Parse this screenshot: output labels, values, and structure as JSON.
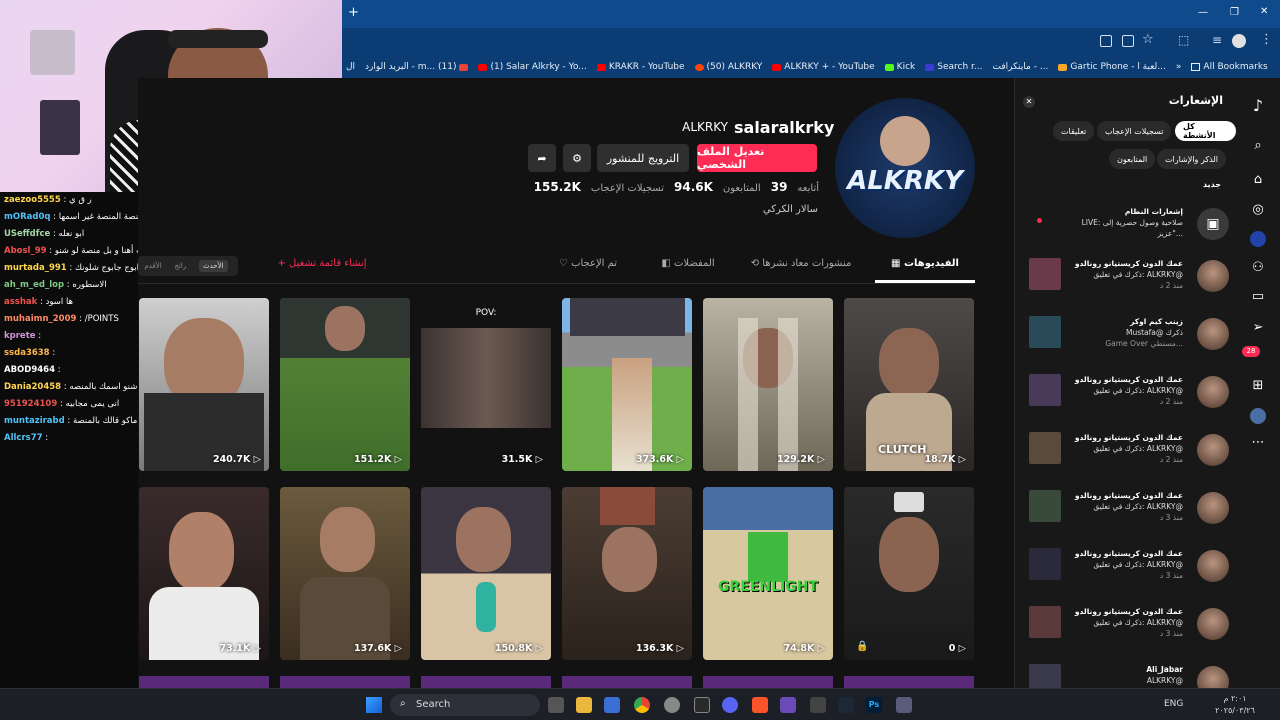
{
  "browser": {
    "new_tab_glyph": "+",
    "bookmarks": [
      {
        "label": "ماينكرافت - ...",
        "icon": "link-icon"
      },
      {
        "label": "Search r...",
        "icon": "kick-k-icon"
      },
      {
        "label": "Kick",
        "icon": "kick-icon"
      },
      {
        "label": "ALKRKY + - YouTube",
        "icon": "youtube-icon"
      },
      {
        "label": "(50) ALKRKY",
        "icon": "reddit-icon"
      },
      {
        "label": "KRAKR - YouTube",
        "icon": "youtube-icon"
      },
      {
        "label": "(1) Salar Alkrky - Yo...",
        "icon": "youtube-icon"
      },
      {
        "label": "البريد الوارد - m... (11)",
        "icon": "gmail-icon"
      },
      {
        "label": "ال",
        "icon": "link-icon"
      }
    ],
    "gartic": "Gartic Phone - لعبة ا...",
    "all_bookmarks": "All Bookmarks",
    "overflow": "»"
  },
  "profile": {
    "username": "salaralkrky",
    "display_name": "ALKRKY",
    "edit_profile": "تعديل الملف الشخصي",
    "promote": "الترويج للمنشور",
    "following_count": "39",
    "following_label": "أتابعه",
    "followers_count": "94.6K",
    "followers_label": "المتابعون",
    "likes_count": "155.2K",
    "likes_label": "تسجيلات الإعجاب",
    "bio": "سالار الكركي",
    "avatar_text": "ALKRKY"
  },
  "tabs": [
    {
      "label": "الفيديوهات",
      "active": true
    },
    {
      "label": "منشورات معاد نشرها",
      "active": false
    },
    {
      "label": "المفضلات",
      "active": false
    },
    {
      "label": "تم الإعجاب",
      "active": false
    }
  ],
  "sort": [
    "الأحدث",
    "رائج",
    "الأقدم"
  ],
  "create_playlist": "+ إنشاء قائمة تشغيل",
  "videos_row1": [
    {
      "views": "18.7K",
      "caption": "CLUTCH"
    },
    {
      "views": "129.2K"
    },
    {
      "views": "373.6K"
    },
    {
      "views": "31.5K",
      "caption": "POV:"
    },
    {
      "views": "151.2K"
    },
    {
      "views": "240.7K"
    }
  ],
  "videos_row2": [
    {
      "views": "0"
    },
    {
      "views": "74.8K",
      "caption": "GREENLIGHT"
    },
    {
      "views": "136.3K"
    },
    {
      "views": "150.8K"
    },
    {
      "views": "137.6K"
    },
    {
      "views": "73.1K"
    }
  ],
  "chat": [
    {
      "user": "zaezoo5555",
      "msg": ": ر ق ي",
      "color": "#ffd54f"
    },
    {
      "user": "mORad0q",
      "msg": ": اسم المنصة المنصة غير اسمها",
      "color": "#4fc3f7"
    },
    {
      "user": "USeffdfce",
      "msg": ": ابو نعله",
      "color": "#a5d6a7"
    },
    {
      "user": "Abosl_99",
      "msg": ": خاله راح بيت أهنا و بل منصة لو شنو",
      "color": "#ef5350"
    },
    {
      "user": "murtada_991",
      "msg": ": ابوج جابوج شلونك",
      "color": "#ffd54f"
    },
    {
      "user": "ah_m_ed_lop",
      "msg": ": الاسطوره",
      "color": "#81c784"
    },
    {
      "user": "asshak",
      "msg": ": ها اسود",
      "color": "#ef5350"
    },
    {
      "user": "muhaimn_2009",
      "msg": ": /POINTS",
      "color": "#ff8a65"
    },
    {
      "user": "kprete",
      "msg": ":",
      "color": "#ce93d8"
    },
    {
      "user": "ssda3638",
      "msg": ":",
      "color": "#ffb74d"
    },
    {
      "user": "ABOD9464",
      "msg": ":",
      "color": "#ffffff"
    },
    {
      "user": "Dania20458",
      "msg": ": شنو اسمك بالمنصه",
      "color": "#ffd54f"
    },
    {
      "user": "951924109",
      "msg": ": انى يمى مجابيه",
      "color": "#ef5350"
    },
    {
      "user": "muntazirabd",
      "msg": ": ماكو قالك بالمنصة",
      "color": "#4fc3f7"
    },
    {
      "user": "Allcrs77",
      "msg": ":",
      "color": "#4fc3f7"
    }
  ],
  "notifications": {
    "title": "الإشعارات",
    "chips": [
      "كل الأنشطة",
      "تسجيلات الإعجاب",
      "تعليقات",
      "الذكر والإشارات",
      "المتابعون"
    ],
    "new_label": "جديد",
    "system_title": "إشعارات النظام",
    "system_text": "LIVE: صلاحية وصول حصرية إلى \"عزيز...",
    "items": [
      {
        "line1": "عمك الدون كريستيانو رونالدو",
        "line2": "ذكرك في تعليق: ALKRKY@",
        "time": "منذ 2 د"
      },
      {
        "line1": "زينب كيم اوكر",
        "line2": "Mustafa@ ذكرك",
        "time": "Game Over مستطي..."
      },
      {
        "line1": "عمك الدون كريستيانو رونالدو",
        "line2": "ذكرك في تعليق: ALKRKY@",
        "time": "منذ 2 د"
      },
      {
        "line1": "عمك الدون كريستيانو رونالدو",
        "line2": "ذكرك في تعليق: ALKRKY@",
        "time": "منذ 2 د"
      },
      {
        "line1": "عمك الدون كريستيانو رونالدو",
        "line2": "ذكرك في تعليق: ALKRKY@",
        "time": "منذ 3 د"
      },
      {
        "line1": "عمك الدون كريستيانو رونالدو",
        "line2": "ذكرك في تعليق: ALKRKY@",
        "time": "منذ 3 د"
      },
      {
        "line1": "عمك الدون كريستيانو رونالدو",
        "line2": "ذكرك في تعليق: ALKRKY@",
        "time": "منذ 3 د"
      },
      {
        "line1": "Ali_Jabar",
        "line2": "ALKRKY@",
        "time": ""
      }
    ]
  },
  "rail_badge": "28",
  "taskbar": {
    "search": "Search",
    "lang": "ENG",
    "time": "٢:٠١ م",
    "date": "٢٠٢٥/٠٣/٢٦"
  },
  "colors": {
    "accent": "#fe2c55",
    "chrome_blue": "#0b3c73"
  }
}
